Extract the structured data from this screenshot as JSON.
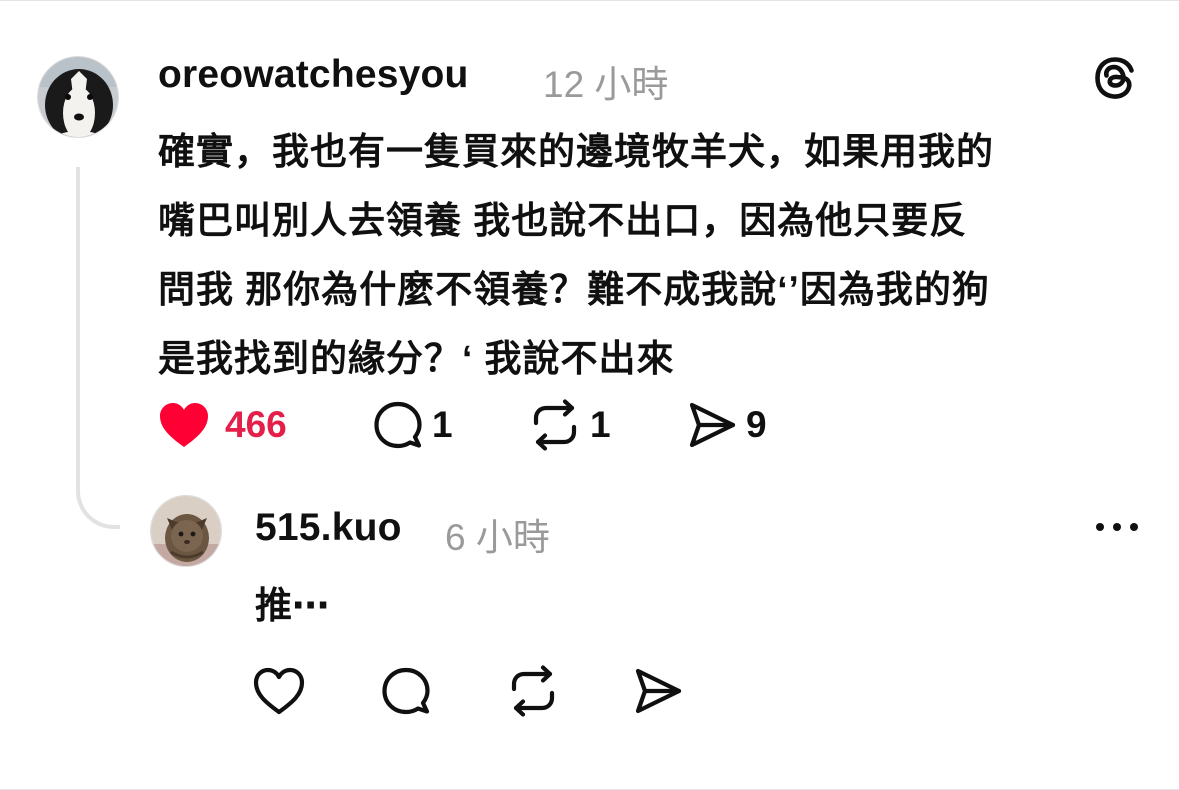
{
  "post": {
    "username": "oreowatchesyou",
    "time": "12 小時",
    "lines": [
      "確實，我也有一隻買來的邊境牧羊犬，如果用我的",
      "嘴巴叫別人去領養 我也說不出口，因為他只要反",
      "問我 那你為什麼不領養？難不成我說‘’因為我的狗",
      "是我找到的緣分？‘ 我說不出來"
    ],
    "likes": "466",
    "comments": "1",
    "reposts": "1",
    "shares": "9",
    "liked": true,
    "like_color": "#e4204a"
  },
  "reply": {
    "username": "515.kuo",
    "time": "6 小時",
    "text": "推⋯"
  },
  "icons": {
    "app_logo": "threads-logo-icon",
    "more": "more-options-icon",
    "like": "heart-icon",
    "comment": "comment-bubble-icon",
    "repost": "repost-icon",
    "share": "send-icon"
  }
}
